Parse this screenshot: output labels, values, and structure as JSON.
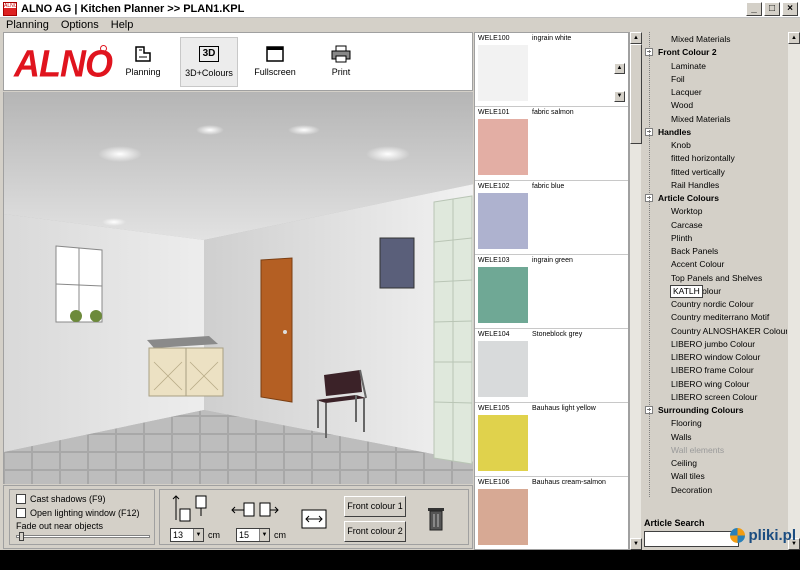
{
  "window": {
    "title": "ALNO AG | Kitchen Planner  >> PLAN1.KPL",
    "icon_text": "ALNO",
    "buttons": {
      "min": "_",
      "max": "□",
      "close": "×"
    }
  },
  "menu": [
    "Planning",
    "Options",
    "Help"
  ],
  "logo": "ALNO",
  "toolbar": {
    "planning": "Planning",
    "colours": "3D+Colours",
    "colours_icon": "3D",
    "fullscreen": "Fullscreen",
    "print": "Print"
  },
  "options": {
    "cast_shadows": "Cast shadows (F9)",
    "open_lighting": "Open lighting window (F12)",
    "fade_out": "Fade out near objects"
  },
  "dimensions": {
    "height_value": "13",
    "width_value": "15",
    "unit": "cm",
    "front_colour_1": "Front colour 1",
    "front_colour_2": "Front colour 2"
  },
  "swatches": [
    {
      "code": "WELE100",
      "name": "ingrain white",
      "color": "#f2f2f2"
    },
    {
      "code": "WELE101",
      "name": "fabric salmon",
      "color": "#e3aea4"
    },
    {
      "code": "WELE102",
      "name": "fabric blue",
      "color": "#aeb2cf"
    },
    {
      "code": "WELE103",
      "name": "ingrain green",
      "color": "#6fa895"
    },
    {
      "code": "WELE104",
      "name": "Stoneblock grey",
      "color": "#d8dadb"
    },
    {
      "code": "WELE105",
      "name": "Bauhaus light yellow",
      "color": "#e0d24c"
    },
    {
      "code": "WELE106",
      "name": "Bauhaus cream-salmon",
      "color": "#d7a994"
    }
  ],
  "tree": [
    {
      "label": "Mixed Materials",
      "type": "leaf"
    },
    {
      "label": "Front Colour 2",
      "type": "cat"
    },
    {
      "label": "Laminate",
      "type": "leaf"
    },
    {
      "label": "Foil",
      "type": "leaf"
    },
    {
      "label": "Lacquer",
      "type": "leaf"
    },
    {
      "label": "Wood",
      "type": "leaf"
    },
    {
      "label": "Mixed Materials",
      "type": "leaf"
    },
    {
      "label": "Handles",
      "type": "cat"
    },
    {
      "label": "Knob",
      "type": "leaf"
    },
    {
      "label": "fitted horizontally",
      "type": "leaf"
    },
    {
      "label": "fitted vertically",
      "type": "leaf"
    },
    {
      "label": "Rail Handles",
      "type": "leaf"
    },
    {
      "label": "Article Colours",
      "type": "cat"
    },
    {
      "label": "Worktop",
      "type": "leaf"
    },
    {
      "label": "Carcase",
      "type": "leaf"
    },
    {
      "label": "Plinth",
      "type": "leaf"
    },
    {
      "label": "Back Panels",
      "type": "leaf"
    },
    {
      "label": "Accent Colour",
      "type": "leaf"
    },
    {
      "label": "Top Panels and Shelves",
      "type": "leaf"
    },
    {
      "label": "antico Colour",
      "type": "leaf"
    },
    {
      "label": "Country nordic Colour",
      "type": "leaf"
    },
    {
      "label": "Country mediterrano Motif",
      "type": "leaf"
    },
    {
      "label": "Country ALNOSHAKER Colour",
      "type": "leaf"
    },
    {
      "label": "LIBERO jumbo Colour",
      "type": "leaf"
    },
    {
      "label": "LIBERO window Colour",
      "type": "leaf"
    },
    {
      "label": "LIBERO frame Colour",
      "type": "leaf"
    },
    {
      "label": "LIBERO wing Colour",
      "type": "leaf"
    },
    {
      "label": "LIBERO screen Colour",
      "type": "leaf"
    },
    {
      "label": "Surrounding Colours",
      "type": "cat"
    },
    {
      "label": "Flooring",
      "type": "leaf"
    },
    {
      "label": "Walls",
      "type": "leaf"
    },
    {
      "label": "Wall elements",
      "type": "dim"
    },
    {
      "label": "Ceiling",
      "type": "leaf"
    },
    {
      "label": "Wall tiles",
      "type": "leaf"
    },
    {
      "label": "Decoration",
      "type": "leaf"
    }
  ],
  "tooltip": "KATLH",
  "search": {
    "label": "Article Search",
    "value": ""
  },
  "watermark": "pliki.pl"
}
